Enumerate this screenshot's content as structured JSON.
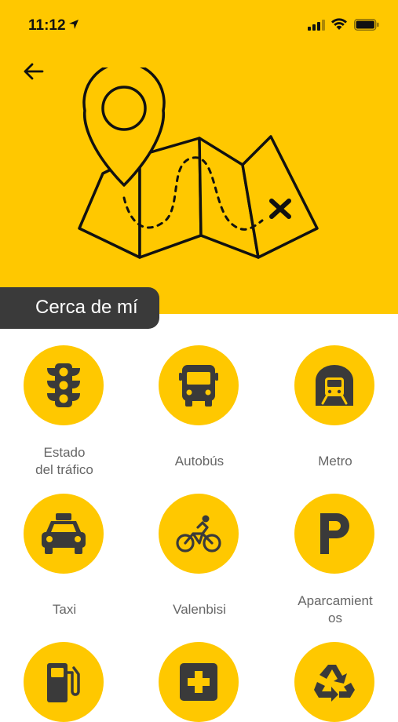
{
  "status_bar": {
    "time": "11:12"
  },
  "header": {
    "title": "Cerca de mí"
  },
  "items": [
    {
      "label": "Estado\ndel tráfico",
      "icon": "traffic-light-icon"
    },
    {
      "label": "Autobús",
      "icon": "bus-icon"
    },
    {
      "label": "Metro",
      "icon": "metro-icon"
    },
    {
      "label": "Taxi",
      "icon": "taxi-icon"
    },
    {
      "label": "Valenbisi",
      "icon": "bicycle-icon"
    },
    {
      "label": "Aparcamient\nos",
      "icon": "parking-icon"
    },
    {
      "label": "",
      "icon": "fuel-station-icon"
    },
    {
      "label": "",
      "icon": "pharmacy-cross-icon"
    },
    {
      "label": "",
      "icon": "recycling-icon"
    }
  ],
  "colors": {
    "accent": "#FFC800",
    "icon": "#3a3a3a",
    "title_tab": "#3a3a3a",
    "label": "#666666"
  }
}
